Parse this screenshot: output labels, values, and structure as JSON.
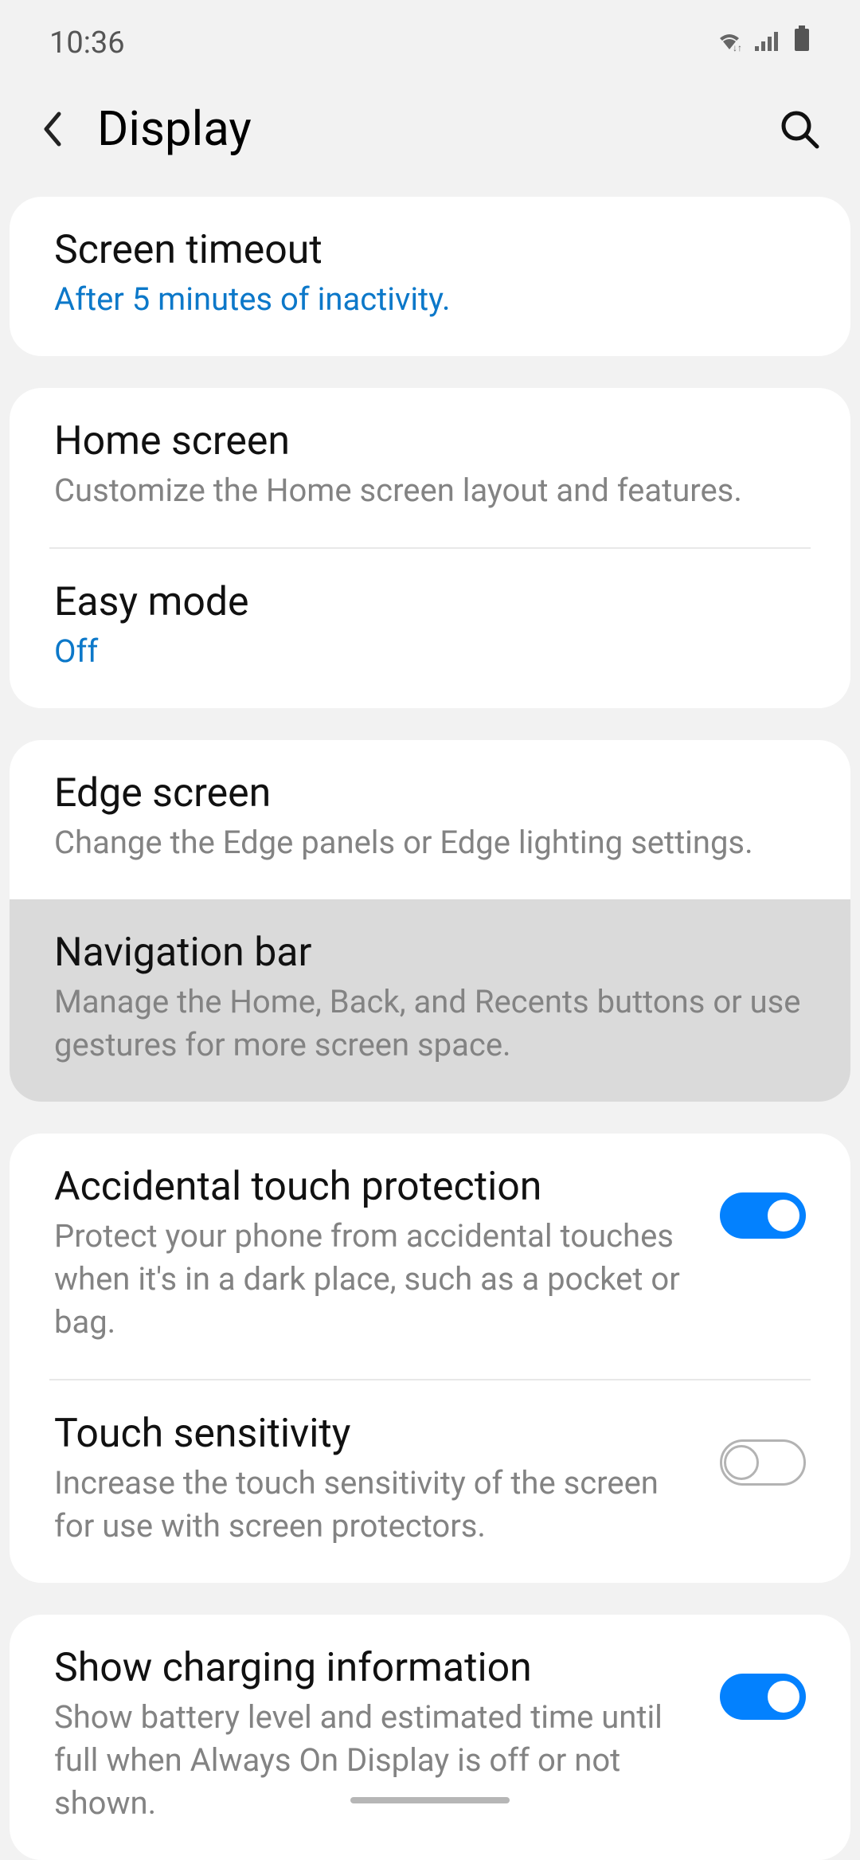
{
  "status": {
    "time": "10:36"
  },
  "header": {
    "title": "Display"
  },
  "sections": [
    {
      "items": [
        {
          "title": "Screen timeout",
          "sub": "After 5 minutes of inactivity.",
          "sub_blue": true
        }
      ]
    },
    {
      "items": [
        {
          "title": "Home screen",
          "sub": "Customize the Home screen layout and features.",
          "sub_blue": false
        },
        {
          "title": "Easy mode",
          "sub": "Off",
          "sub_blue": true
        }
      ]
    },
    {
      "items": [
        {
          "title": "Edge screen",
          "sub": "Change the Edge panels or Edge lighting settings.",
          "sub_blue": false
        },
        {
          "title": "Navigation bar",
          "sub": "Manage the Home, Back, and Recents buttons or use gestures for more screen space.",
          "sub_blue": false,
          "highlighted": true
        }
      ]
    },
    {
      "items": [
        {
          "title": "Accidental touch protection",
          "sub": "Protect your phone from accidental touches when it's in a dark place, such as a pocket or bag.",
          "toggle": true,
          "toggle_on": true
        },
        {
          "title": "Touch sensitivity",
          "sub": "Increase the touch sensitivity of the screen for use with screen protectors.",
          "toggle": true,
          "toggle_on": false
        }
      ]
    },
    {
      "items": [
        {
          "title": "Show charging information",
          "sub": "Show battery level and estimated time until full when Always On Display is off or not shown.",
          "toggle": true,
          "toggle_on": true
        }
      ]
    }
  ]
}
